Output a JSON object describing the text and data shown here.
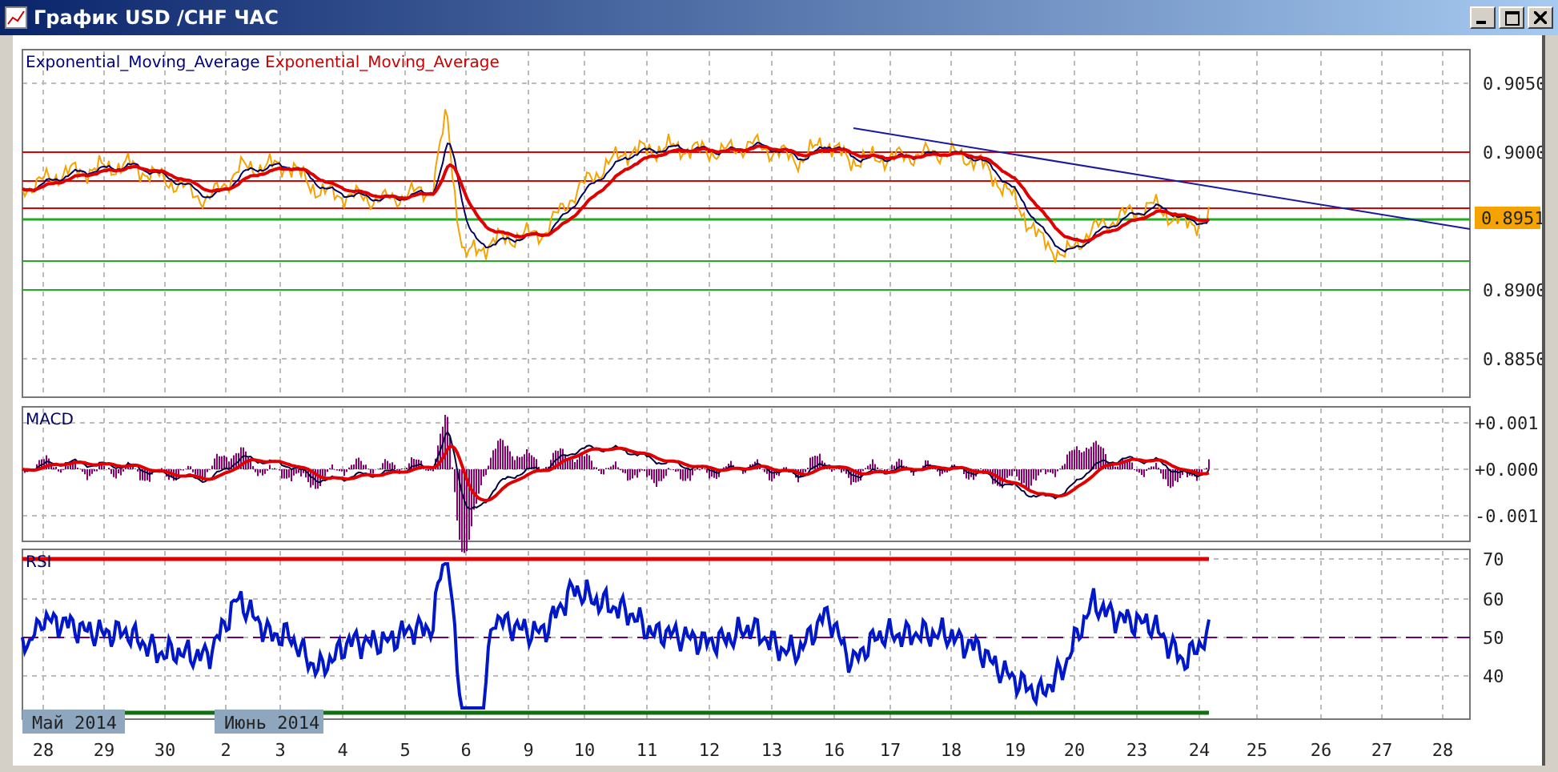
{
  "window": {
    "title": "График USD /CHF ЧАС"
  },
  "main_pane": {
    "legend": [
      {
        "text": "Exponential_Moving_Average",
        "color": "#000080"
      },
      {
        "text": "Exponential_Moving_Average",
        "color": "#cc0000"
      }
    ],
    "price_axis": [
      "0.9050",
      "0.9000",
      "0.8900",
      "0.8850"
    ],
    "current_price": "0.8951"
  },
  "macd_pane": {
    "label": "MACD",
    "axis": [
      "+0.001",
      "+0.000",
      "-0.001"
    ]
  },
  "rsi_pane": {
    "label": "RSI",
    "axis": [
      "70",
      "60",
      "50",
      "40"
    ]
  },
  "time_axis": {
    "labels": [
      "28",
      "29",
      "30",
      "2",
      "3",
      "4",
      "5",
      "6",
      "9",
      "10",
      "11",
      "12",
      "13",
      "16",
      "17",
      "18",
      "19",
      "20",
      "23",
      "24",
      "25",
      "26",
      "27",
      "28"
    ],
    "month_labels": [
      "Май 2014",
      "Июнь 2014"
    ]
  }
}
